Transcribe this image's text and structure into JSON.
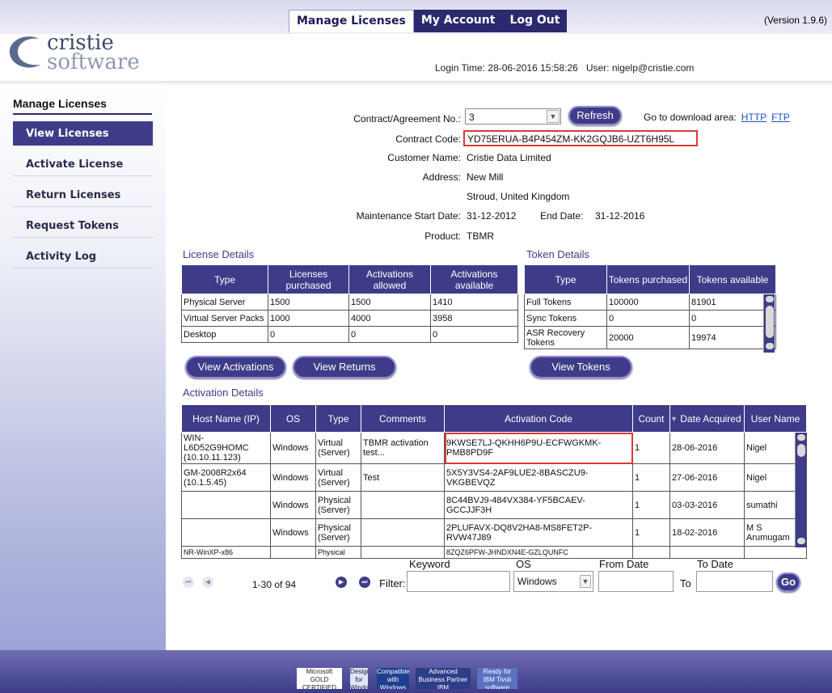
{
  "nav": {
    "items": [
      {
        "label": "Manage Licenses",
        "active": true
      },
      {
        "label": "My Account",
        "active": false
      },
      {
        "label": "Log Out",
        "active": false
      }
    ],
    "version": "(Version 1.9.6)"
  },
  "logo": {
    "line1": "cristie",
    "line2": "software"
  },
  "login": {
    "time_label": "Login Time:",
    "time": "28-06-2016 15:58:26",
    "user_label": "User:",
    "user": "nigelp@cristie.com"
  },
  "sidebar": {
    "title": "Manage Licenses",
    "items": [
      {
        "label": "View Licenses",
        "active": true
      },
      {
        "label": "Activate License",
        "active": false
      },
      {
        "label": "Return Licenses",
        "active": false
      },
      {
        "label": "Request Tokens",
        "active": false
      },
      {
        "label": "Activity Log",
        "active": false
      }
    ]
  },
  "contract": {
    "agreement_label": "Contract/Agreement No.:",
    "agreement_value": "3",
    "refresh_label": "Refresh",
    "download_label": "Go to download area:",
    "http_link": "HTTP",
    "ftp_link": "FTP",
    "code_label": "Contract Code:",
    "code_value": "YD75ERUA-B4P454ZM-KK2GQJB6-UZT6H95L",
    "customer_label": "Customer Name:",
    "customer_value": "Cristie Data Limited",
    "address_label": "Address:",
    "address_line1": "New Mill",
    "address_line2": "Stroud, United Kingdom",
    "maint_start_label": "Maintenance Start Date:",
    "maint_start_value": "31-12-2012",
    "end_label": "End Date:",
    "end_value": "31-12-2016",
    "product_label": "Product:",
    "product_value": "TBMR"
  },
  "license_details": {
    "title": "License Details",
    "headers": [
      "Type",
      "Licenses purchased",
      "Activations allowed",
      "Activations available"
    ],
    "rows": [
      [
        "Physical Server",
        "1500",
        "1500",
        "1410"
      ],
      [
        "Virtual Server Packs",
        "1000",
        "4000",
        "3958"
      ],
      [
        "Desktop",
        "0",
        "0",
        "0"
      ]
    ]
  },
  "token_details": {
    "title": "Token Details",
    "headers": [
      "Type",
      "Tokens purchased",
      "Tokens available"
    ],
    "rows": [
      [
        "Full Tokens",
        "100000",
        "81901"
      ],
      [
        "Sync Tokens",
        "0",
        "0"
      ],
      [
        "ASR Recovery Tokens",
        "20000",
        "19974"
      ]
    ]
  },
  "buttons": {
    "view_activations": "View Activations",
    "view_returns": "View Returns",
    "view_tokens": "View Tokens"
  },
  "activation_details": {
    "title": "Activation Details",
    "headers": [
      "Host Name (IP)",
      "OS",
      "Type",
      "Comments",
      "Activation Code",
      "Count",
      "Date Acquired",
      "User Name"
    ],
    "rows": [
      [
        "WIN-L6D52G9HOMC (10.10.11.123)",
        "Windows",
        "Virtual (Server)",
        "TBMR activation test...",
        "9KWSE7LJ-QKHH6P9U-ECFWGKMK-PMB8PD9F",
        "1",
        "28-06-2016",
        "Nigel"
      ],
      [
        "GM-2008R2x64 (10.1.5.45)",
        "Windows",
        "Virtual (Server)",
        "Test",
        "5X5Y3VS4-2AF9LUE2-8BASCZU9-VKGBEVQZ",
        "1",
        "27-06-2016",
        "Nigel"
      ],
      [
        "",
        "Windows",
        "Physical (Server)",
        "",
        "8C44BVJ9-484VX384-YF5BCAEV-GCCJJF3H",
        "1",
        "03-03-2016",
        "sumathi"
      ],
      [
        "",
        "Windows",
        "Physical (Server)",
        "",
        "2PLUFAVX-DQ8V2HA8-MS8FET2P-RVW47J89",
        "1",
        "18-02-2016",
        "M S Arumugam"
      ],
      [
        "NR-WinXP-x86",
        "",
        "Physical",
        "",
        "8ZQZ6PFW-JHNDXN4E-GZLQUNFC",
        "",
        "",
        ""
      ]
    ]
  },
  "filter": {
    "range": "1-30 of 94",
    "filter_label": "Filter:",
    "keyword_label": "Keyword",
    "os_label": "OS",
    "os_value": "Windows",
    "from_label": "From Date",
    "to_label": "To Date",
    "to_word": "To",
    "go_label": "Go"
  },
  "footer": {
    "badges": [
      "Microsoft GOLD CERTIFIED Partner",
      "Designed for Windows",
      "Compatible with Windows",
      "Advanced Business Partner IBM",
      "Ready for IBM Tivoli software"
    ]
  }
}
